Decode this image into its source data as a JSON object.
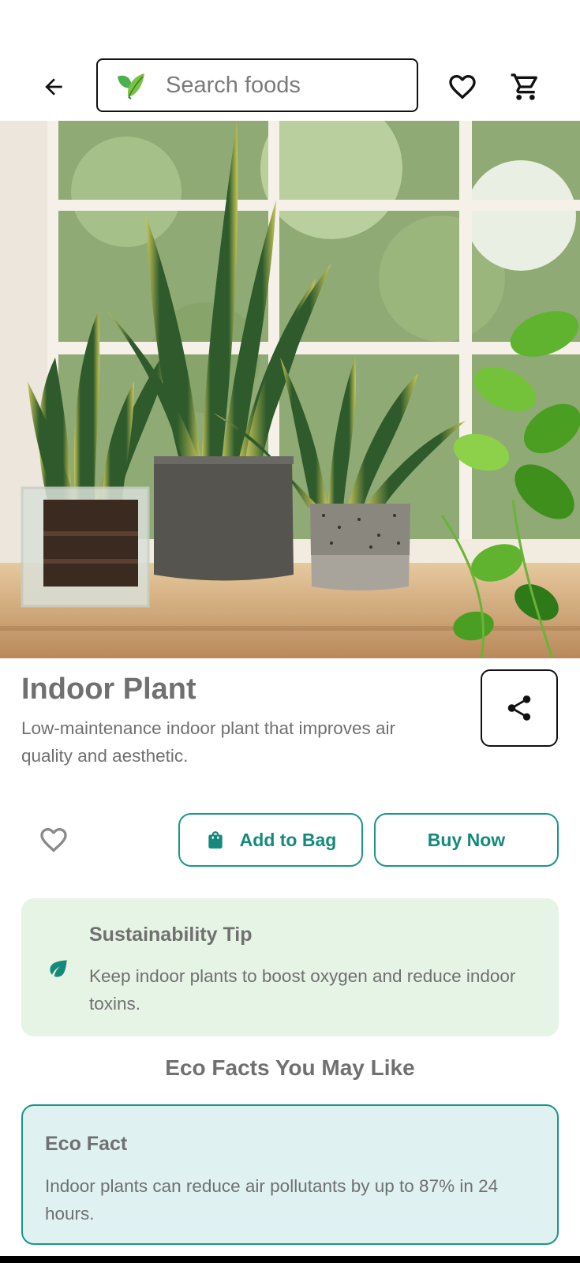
{
  "search": {
    "placeholder": "Search foods"
  },
  "product": {
    "title": "Indoor Plant",
    "description": "Low-maintenance indoor plant that improves air quality and aesthetic."
  },
  "actions": {
    "add_to_bag": "Add to Bag",
    "buy_now": "Buy Now"
  },
  "tip": {
    "title": "Sustainability Tip",
    "text": "Keep indoor plants to boost oxygen and reduce indoor toxins."
  },
  "section": {
    "title": "Eco Facts You May Like"
  },
  "eco_fact": {
    "title": "Eco Fact",
    "text": "Indoor plants can reduce air pollutants by up to 87% in 24 hours."
  },
  "icons": {
    "back": "arrow-left-icon",
    "search_leaf": "leaf-icon",
    "favorite": "heart-outline-icon",
    "cart": "cart-icon",
    "share": "share-icon",
    "bag": "shopping-bag-icon",
    "tip": "eco-leaf-icon"
  },
  "colors": {
    "accent": "#1a9688",
    "tip_bg": "#e6f4e6",
    "fact_bg": "#e0f1f1"
  }
}
